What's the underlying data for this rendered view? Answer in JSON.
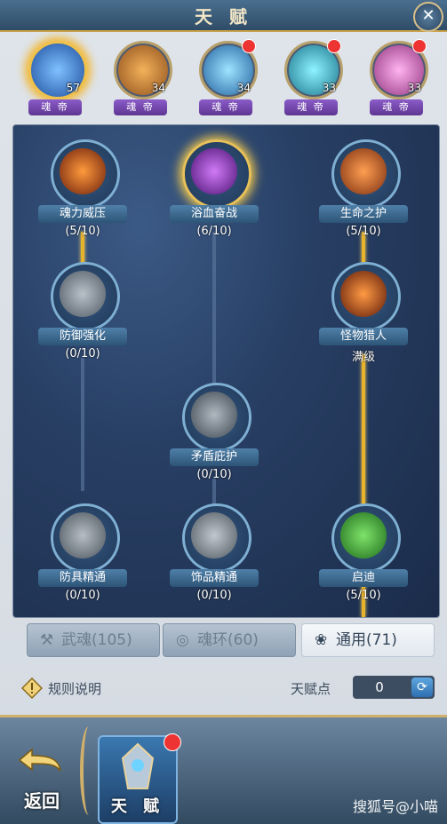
{
  "window": {
    "title": "天 赋",
    "close_icon": "close-icon"
  },
  "heroes": [
    {
      "level": "57",
      "rank": "魂 帝",
      "selected": true,
      "badge": false,
      "color": "#3b7fd1"
    },
    {
      "level": "34",
      "rank": "魂 帝",
      "selected": false,
      "badge": false,
      "color": "#c57a2c"
    },
    {
      "level": "34",
      "rank": "魂 帝",
      "selected": false,
      "badge": true,
      "color": "#2d8fd6"
    },
    {
      "level": "33",
      "rank": "魂 帝",
      "selected": false,
      "badge": true,
      "color": "#2a9fb8"
    },
    {
      "level": "33",
      "rank": "魂 帝",
      "selected": false,
      "badge": true,
      "color": "#c75ab5"
    }
  ],
  "talents": [
    {
      "name": "魂力威压",
      "progress": "(5/10)",
      "icon": "warrior-icon",
      "active": false
    },
    {
      "name": "浴血奋战",
      "progress": "(6/10)",
      "icon": "blood-rage-icon",
      "active": true
    },
    {
      "name": "生命之护",
      "progress": "(5/10)",
      "icon": "shield-life-icon",
      "active": false
    },
    {
      "name": "防御强化",
      "progress": "(0/10)",
      "icon": "winged-shield-icon",
      "active": false
    },
    {
      "name": "怪物猎人",
      "progress": "满级",
      "icon": "monster-hunter-icon",
      "active": false
    },
    {
      "name": "矛盾庇护",
      "progress": "(0/10)",
      "icon": "cross-shield-icon",
      "active": false
    },
    {
      "name": "防具精通",
      "progress": "(0/10)",
      "icon": "hammer-icon",
      "active": false
    },
    {
      "name": "饰品精通",
      "progress": "(0/10)",
      "icon": "ring-icon",
      "active": false
    },
    {
      "name": "启迪",
      "progress": "(5/10)",
      "icon": "potion-icon",
      "active": false
    }
  ],
  "tabs": [
    {
      "label": "武魂(105)",
      "icon": "hammer-tab-icon",
      "active": false
    },
    {
      "label": "魂环(60)",
      "icon": "ring-tab-icon",
      "active": false
    },
    {
      "label": "通用(71)",
      "icon": "lotus-tab-icon",
      "active": true
    }
  ],
  "rules": {
    "label": "规则说明",
    "icon": "warning-icon"
  },
  "points": {
    "label": "天赋点",
    "value": "0",
    "refresh_icon": "refresh-icon"
  },
  "bottom": {
    "back_label": "返回",
    "talent_label": "天 赋"
  },
  "watermark": "搜狐号@小喵",
  "colors": {
    "accent_gold": "#e7b32b",
    "badge_red": "#e33333",
    "panel_blue": "#283f64"
  }
}
